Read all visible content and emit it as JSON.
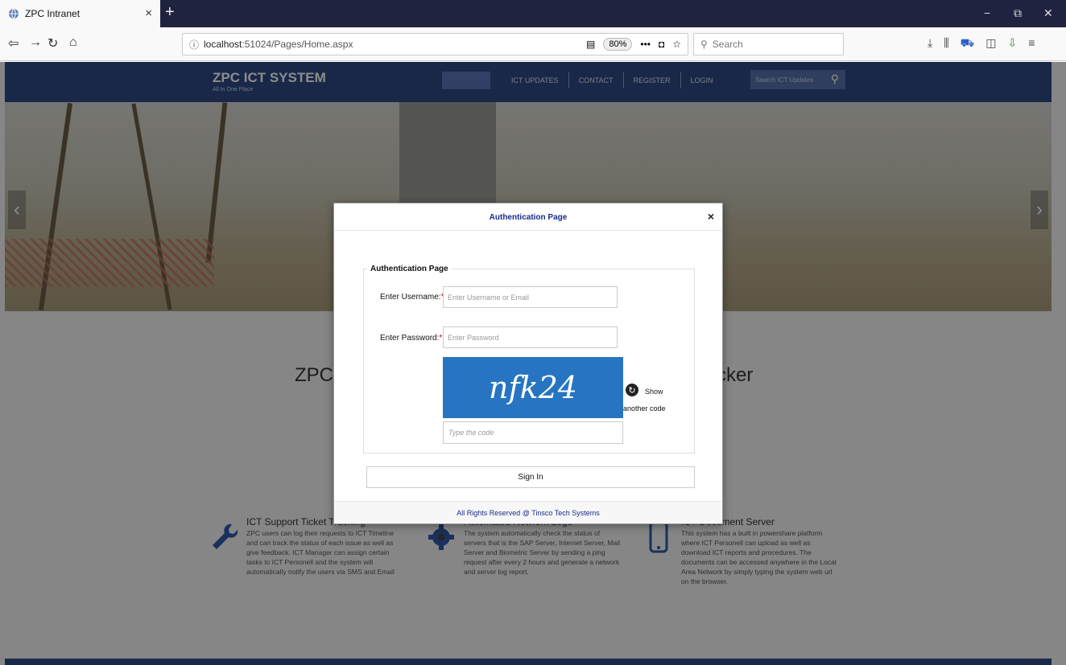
{
  "browser": {
    "tab_title": "ZPC Intranet",
    "tab_close": "×",
    "new_tab": "+",
    "url_host": "localhost",
    "url_path": ":51024/Pages/Home.aspx",
    "zoom": "80%",
    "search_placeholder": "Search",
    "window_controls": [
      "−",
      "⧉",
      "✕"
    ]
  },
  "site": {
    "brand": "ZPC ICT SYSTEM",
    "brand_sub": "All In One Place",
    "menu": [
      "ICT UPDATES",
      "CONTACT",
      "REGISTER",
      "LOGIN"
    ],
    "search_placeholder": "Search ICT Updates",
    "main_title_left": "ZPC",
    "main_title_right": "cker",
    "features": [
      {
        "title": "ICT Support Ticket Tracking",
        "text": "ZPC users can log their requests to ICT Timeline and can track the status of each issue as well as give feedback. ICT Manager can assign certain tasks to ICT Personell and the system will automatically notify the users via SMS and Email",
        "icon": "wrench-icon"
      },
      {
        "title": "Automated Network Logs",
        "text": "The system automatically check the status of servers that is the SAP Server, Internet Server, Mail Server and Biometric Server by sending a ping request after every 2 hours and generate a network and server log report.",
        "icon": "gear-icon"
      },
      {
        "title": "ICT Document Server",
        "text": "This system has a built in powershare platform where ICT Personell can upload as well as download ICT reports and procedures. The documents can be accessed anywhere in the Local Area Network by simply typing the system web url on the browser.",
        "icon": "mobile-icon"
      }
    ]
  },
  "modal": {
    "title": "Authentication Page",
    "close": "×",
    "legend": "Authentication Page",
    "username_label": "Enter Username:",
    "username_placeholder": "Enter Username or Email",
    "password_label": "Enter Password:",
    "password_placeholder": "Enter Password",
    "required_mark": "*",
    "captcha_text": "nfk24",
    "show_text": "Show",
    "another_code": "another code",
    "type_code_placeholder": "Type the code",
    "sign_in": "Sign In",
    "footer": "All Rights Reserved @ Tinsco Tech Systems"
  }
}
